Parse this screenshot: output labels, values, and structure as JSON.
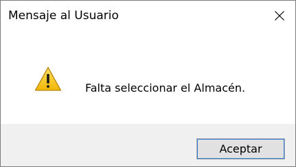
{
  "window": {
    "title": "Mensaje al Usuario",
    "close_symbol": "✕"
  },
  "message": {
    "icon": "warning-icon",
    "text": "Falta seleccionar el Almacén."
  },
  "buttons": {
    "ok_label": "Aceptar"
  },
  "colors": {
    "footer_bg": "#f0f0f0",
    "warning_yellow": "#f5c518",
    "focus_border": "#2e7bd6"
  }
}
